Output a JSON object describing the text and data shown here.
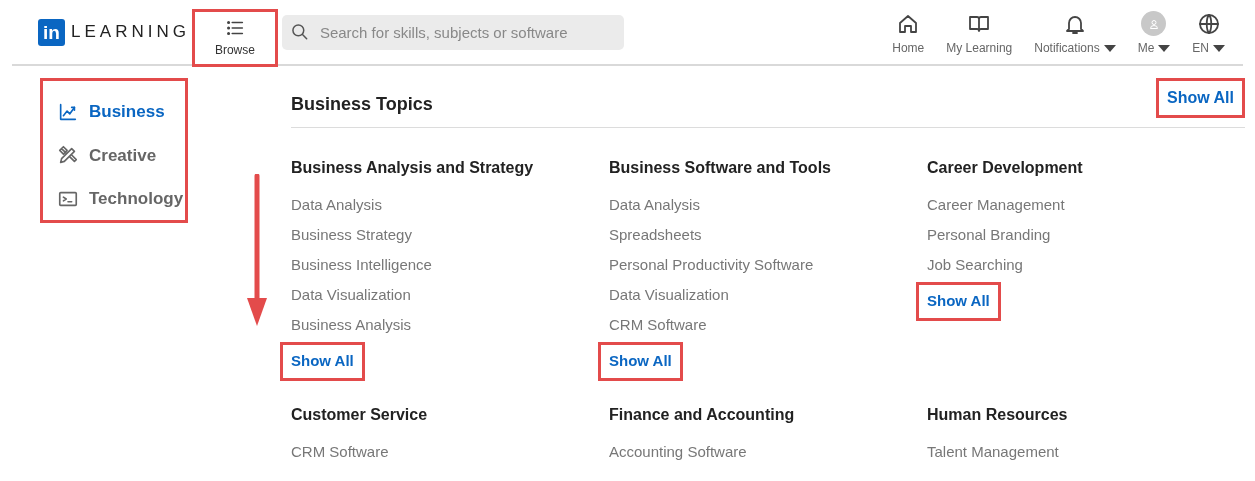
{
  "header": {
    "logo_badge": "in",
    "logo_text": "LEARNING",
    "browse": {
      "label": "Browse",
      "annotated": true
    },
    "search": {
      "placeholder": "Search for skills, subjects or software"
    },
    "nav": [
      {
        "kind": "home",
        "label": "Home",
        "dropdown": false
      },
      {
        "kind": "book",
        "label": "My Learning",
        "dropdown": false
      },
      {
        "kind": "bell",
        "label": "Notifications",
        "dropdown": true
      },
      {
        "kind": "avatar",
        "label": "Me",
        "dropdown": true
      },
      {
        "kind": "globe",
        "label": "EN",
        "dropdown": true
      }
    ]
  },
  "sidebar": {
    "annotated": true,
    "items": [
      {
        "kind": "chart",
        "label": "Business",
        "selected": true
      },
      {
        "kind": "tools",
        "label": "Creative",
        "selected": false
      },
      {
        "kind": "terminal",
        "label": "Technology",
        "selected": false
      }
    ]
  },
  "annotation_arrow": true,
  "topics": {
    "title": "Business Topics",
    "show_all": {
      "label": "Show All",
      "annotated": true
    },
    "sections": [
      {
        "heading": "Business Analysis and Strategy",
        "items": [
          "Data Analysis",
          "Business Strategy",
          "Business Intelligence",
          "Data Visualization",
          "Business Analysis"
        ],
        "show_all": {
          "label": "Show All",
          "annotated": true
        }
      },
      {
        "heading": "Business Software and Tools",
        "items": [
          "Data Analysis",
          "Spreadsheets",
          "Personal Productivity Software",
          "Data Visualization",
          "CRM Software"
        ],
        "show_all": {
          "label": "Show All",
          "annotated": true
        }
      },
      {
        "heading": "Career Development",
        "items": [
          "Career Management",
          "Personal Branding",
          "Job Searching"
        ],
        "show_all": {
          "label": "Show All",
          "annotated": true
        }
      },
      {
        "heading": "Customer Service",
        "items": [
          "CRM Software"
        ]
      },
      {
        "heading": "Finance and Accounting",
        "items": [
          "Accounting Software"
        ]
      },
      {
        "heading": "Human Resources",
        "items": [
          "Talent Management"
        ]
      }
    ]
  }
}
